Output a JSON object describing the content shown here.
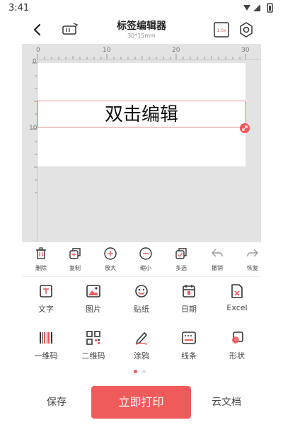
{
  "status_bar": {
    "time": "3:41"
  },
  "header": {
    "title": "标签编辑器",
    "subtitle": "30*15mm",
    "zoom_badge": "1.0x"
  },
  "ruler": {
    "top_ticks": [
      "0",
      "10",
      "20",
      "30"
    ],
    "left_ticks": [
      "0",
      "10"
    ]
  },
  "canvas": {
    "text": "双击编辑"
  },
  "toolbar": {
    "items": [
      {
        "label": "删除"
      },
      {
        "label": "复制"
      },
      {
        "label": "放大"
      },
      {
        "label": "缩小"
      },
      {
        "label": "多选"
      },
      {
        "label": "撤销"
      },
      {
        "label": "恢复"
      }
    ]
  },
  "insert_grid": {
    "items": [
      {
        "label": "文字"
      },
      {
        "label": "图片"
      },
      {
        "label": "贴纸"
      },
      {
        "label": "日期"
      },
      {
        "label": "Excel"
      },
      {
        "label": "一维码"
      },
      {
        "label": "二维码"
      },
      {
        "label": "涂鸦"
      },
      {
        "label": "线条"
      },
      {
        "label": "形状"
      }
    ],
    "page_index": 1,
    "page_count": 2
  },
  "bottom_bar": {
    "save": "保存",
    "print": "立即打印",
    "cloud": "云文档"
  },
  "colors": {
    "accent": "#ef5b5b",
    "canvas_bg": "#e3e3e3",
    "selection_border": "#f08a8a"
  }
}
